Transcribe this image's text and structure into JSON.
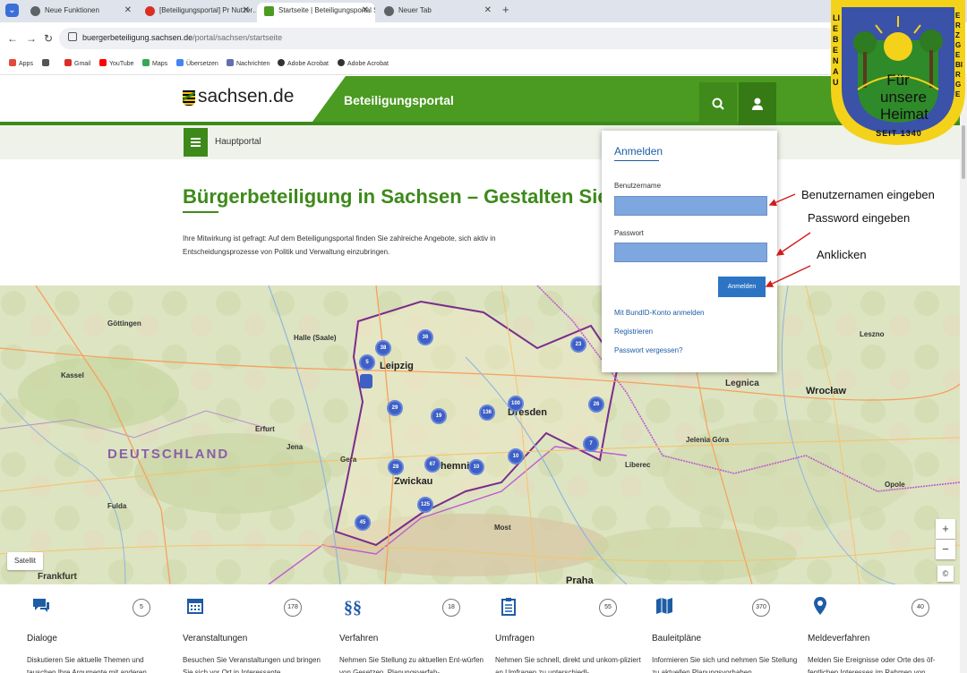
{
  "browser": {
    "tabs": [
      {
        "title": "Neue Funktionen",
        "active": false
      },
      {
        "title": "[Beteiligungsportal] Pr Nutzer…",
        "active": false
      },
      {
        "title": "Startseite | Beteiligungsportal S…",
        "active": true
      },
      {
        "title": "Neuer Tab",
        "active": false
      }
    ],
    "url_host": "buergerbeteiligung.sachsen.de",
    "url_path": "/portal/sachsen/startseite",
    "bookmarks": [
      {
        "label": "Apps",
        "color": "#e24b3b"
      },
      {
        "label": "Gmail",
        "color": "#d93025"
      },
      {
        "label": "YouTube",
        "color": "#ff0000"
      },
      {
        "label": "Maps",
        "color": "#34a853"
      },
      {
        "label": "Übersetzen",
        "color": "#4285f4"
      },
      {
        "label": "Nachrichten",
        "color": "#5f6fb0"
      },
      {
        "label": "Adobe Acrobat",
        "color": "#333333"
      },
      {
        "label": "Adobe Acrobat",
        "color": "#333333"
      }
    ]
  },
  "site": {
    "logo": "sachsen.de",
    "portal": "Beteiligungsportal",
    "subnav": "Hauptportal",
    "title": "Bürgerbeteiligung in Sachsen – Gestalten Sie mit!",
    "intro": "Ihre Mitwirkung ist gefragt: Auf dem Beteiligungsportal finden Sie zahlreiche Angebote, sich aktiv in Entscheidungsprozesse von Politik und Verwaltung einzubringen."
  },
  "map": {
    "satellite": "Satellit",
    "zoom_in": "+",
    "zoom_out": "−",
    "country_label": "DEUTSCHLAND",
    "cities": [
      {
        "name": "Leipzig",
        "big": true
      },
      {
        "name": "Dresden",
        "big": true
      },
      {
        "name": "Chemnitz",
        "big": true
      },
      {
        "name": "Zwickau",
        "big": true
      },
      {
        "name": "Halle (Saale)",
        "big": false
      },
      {
        "name": "Göttingen",
        "big": false
      },
      {
        "name": "Kassel",
        "big": false
      },
      {
        "name": "Erfurt",
        "big": false
      },
      {
        "name": "Jena",
        "big": false
      },
      {
        "name": "Gera",
        "big": false
      },
      {
        "name": "Fulda",
        "big": false
      },
      {
        "name": "Frankfurt",
        "big": false
      },
      {
        "name": "Wrocław",
        "big": true
      },
      {
        "name": "Legnica",
        "big": false
      },
      {
        "name": "Liberec",
        "big": false
      },
      {
        "name": "Praha",
        "big": true
      },
      {
        "name": "Most",
        "big": false
      },
      {
        "name": "Opole",
        "big": false
      },
      {
        "name": "Leszno",
        "big": false
      },
      {
        "name": "Jelenia Góra",
        "big": false
      }
    ],
    "clusters": [
      "36",
      "38",
      "5",
      "29",
      "19",
      "136",
      "100",
      "23",
      "26",
      "7",
      "28",
      "67",
      "10",
      "10",
      "125",
      "45"
    ]
  },
  "categories": [
    {
      "icon": "chat-icon",
      "glyph": "▶",
      "count": "5",
      "title": "Dialoge",
      "desc": "Diskutieren Sie aktuelle Themen und tauschen Ihre Argumente mit anderen"
    },
    {
      "icon": "calendar-icon",
      "glyph": "▦",
      "count": "178",
      "title": "Veranstaltungen",
      "desc": "Besuchen Sie Veranstaltungen und bringen Sie sich vor Ort in Interessante"
    },
    {
      "icon": "paragraph-icon",
      "glyph": "§§",
      "count": "18",
      "title": "Verfahren",
      "desc": "Nehmen Sie Stellung zu aktuellen Ent-würfen von Gesetzen, Planungsverfah-"
    },
    {
      "icon": "clipboard-icon",
      "glyph": "☰",
      "count": "55",
      "title": "Umfragen",
      "desc": "Nehmen Sie schnell, direkt und unkom-pliziert an Umfragen zu unterschiedl-"
    },
    {
      "icon": "map-icon",
      "glyph": "▥",
      "count": "370",
      "title": "Bauleitpläne",
      "desc": "Informieren Sie sich und nehmen Sie Stellung zu aktuellen Planungsvorhaben"
    },
    {
      "icon": "pin-icon",
      "glyph": "●",
      "count": "40",
      "title": "Meldeverfahren",
      "desc": "Melden Sie Ereignisse oder Orte des öf-fentlichen Interesses im Rahmen von"
    }
  ],
  "login": {
    "title": "Anmelden",
    "user_label": "Benutzername",
    "pass_label": "Passwort",
    "submit": "Anmelden",
    "links": [
      "Mit BundID-Konto anmelden",
      "Registrieren",
      "Passwort vergessen?"
    ]
  },
  "annotations": {
    "user": "Benutzernamen eingeben",
    "pass": "Password eingeben",
    "click": "Anklicken"
  },
  "badge": {
    "left": "LIEBENAU",
    "right": "ERZGEBIRGE",
    "line1": "Für",
    "line2": "unsere",
    "line3": "Heimat",
    "since": "SEIT 1340"
  },
  "colors": {
    "brand_green": "#4b9a21",
    "link_blue": "#1e5ca6",
    "input_blue": "#7ea6df",
    "button_blue": "#2e74c4",
    "cluster_blue": "#3e5fc3"
  }
}
